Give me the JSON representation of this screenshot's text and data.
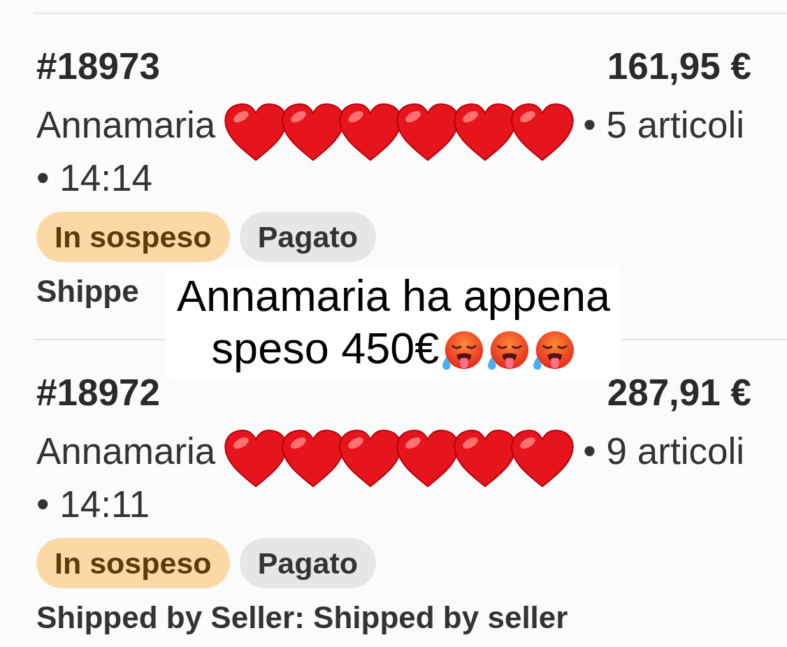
{
  "orders": [
    {
      "number": "#18973",
      "total": "161,95 €",
      "customer": "Annamaria",
      "name_cover": [
        {
          "kind": "heart"
        },
        {
          "kind": "heart"
        },
        {
          "kind": "heart"
        },
        {
          "kind": "heart"
        },
        {
          "kind": "heart"
        },
        {
          "kind": "heart"
        }
      ],
      "items": "• 5 articoli",
      "time": "• 14:14",
      "badges": [
        {
          "label": "In sospeso",
          "kind": "pending"
        },
        {
          "label": "Pagato",
          "kind": "neutral"
        }
      ],
      "shipping": "Shippe"
    },
    {
      "number": "#18972",
      "total": "287,91 €",
      "customer": "Annamaria",
      "name_cover": [
        {
          "kind": "heart"
        },
        {
          "kind": "heart"
        },
        {
          "kind": "heart"
        },
        {
          "kind": "heart"
        },
        {
          "kind": "heart"
        },
        {
          "kind": "heart"
        }
      ],
      "items": "• 9 articoli",
      "time": "• 14:11",
      "badges": [
        {
          "label": "In sospeso",
          "kind": "pending"
        },
        {
          "label": "Pagato",
          "kind": "neutral"
        }
      ],
      "shipping": "Shipped by Seller: Shipped by seller"
    }
  ],
  "caption": {
    "lines": [
      "Annamaria ha appena",
      "speso 450€"
    ],
    "emojis": [
      {
        "kind": "hot-face"
      },
      {
        "kind": "hot-face"
      },
      {
        "kind": "hot-face"
      }
    ]
  }
}
